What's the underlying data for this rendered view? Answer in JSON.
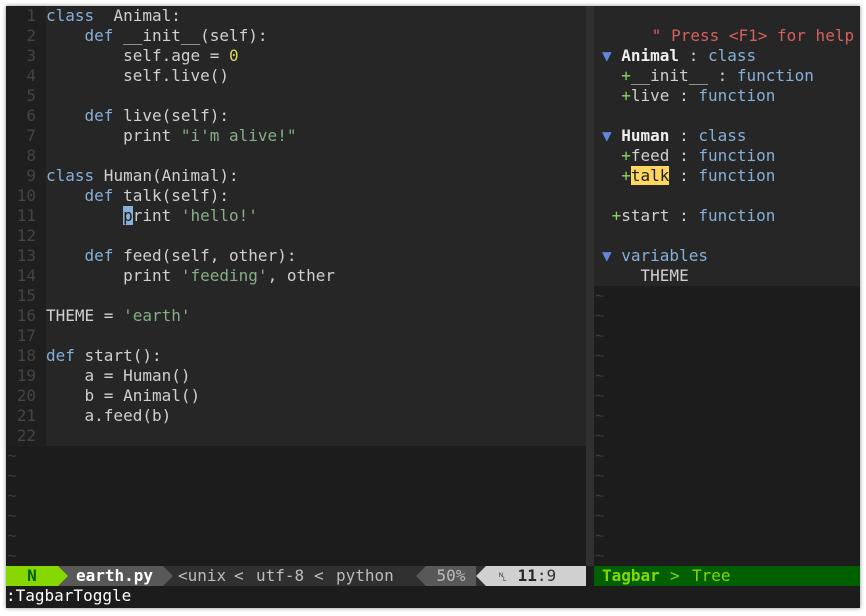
{
  "editor": {
    "lines": [
      {
        "n": "1",
        "segs": [
          [
            "kw",
            "class"
          ],
          [
            "",
            "  "
          ],
          [
            "",
            "Animal:"
          ]
        ]
      },
      {
        "n": "2",
        "segs": [
          [
            "",
            "    "
          ],
          [
            "kw",
            "def"
          ],
          [
            "",
            " __init__(self):"
          ]
        ]
      },
      {
        "n": "3",
        "segs": [
          [
            "",
            "        self.age = "
          ],
          [
            "num",
            "0"
          ]
        ]
      },
      {
        "n": "4",
        "segs": [
          [
            "",
            "        self.live()"
          ]
        ]
      },
      {
        "n": "5",
        "segs": []
      },
      {
        "n": "6",
        "segs": [
          [
            "",
            "    "
          ],
          [
            "kw",
            "def"
          ],
          [
            "",
            " live(self):"
          ]
        ]
      },
      {
        "n": "7",
        "segs": [
          [
            "",
            "        print "
          ],
          [
            "str",
            "\"i'm alive!\""
          ]
        ]
      },
      {
        "n": "8",
        "segs": []
      },
      {
        "n": "9",
        "segs": [
          [
            "kw",
            "class"
          ],
          [
            "",
            " Human(Animal):"
          ]
        ]
      },
      {
        "n": "10",
        "segs": [
          [
            "",
            "    "
          ],
          [
            "kw",
            "def"
          ],
          [
            "",
            " talk(self):"
          ]
        ]
      },
      {
        "n": "11",
        "segs": [
          [
            "",
            "        "
          ],
          [
            "cursor",
            "p"
          ],
          [
            "",
            "rint "
          ],
          [
            "str",
            "'hello!'"
          ]
        ]
      },
      {
        "n": "12",
        "segs": []
      },
      {
        "n": "13",
        "segs": [
          [
            "",
            "    "
          ],
          [
            "kw",
            "def"
          ],
          [
            "",
            " feed(self, other):"
          ]
        ]
      },
      {
        "n": "14",
        "segs": [
          [
            "",
            "        print "
          ],
          [
            "str",
            "'feeding'"
          ],
          [
            "",
            ", other"
          ]
        ]
      },
      {
        "n": "15",
        "segs": []
      },
      {
        "n": "16",
        "segs": [
          [
            "",
            "THEME = "
          ],
          [
            "str",
            "'earth'"
          ]
        ]
      },
      {
        "n": "17",
        "segs": []
      },
      {
        "n": "18",
        "segs": [
          [
            "kw",
            "def"
          ],
          [
            "",
            " start():"
          ]
        ]
      },
      {
        "n": "19",
        "segs": [
          [
            "",
            "    a = Human()"
          ]
        ]
      },
      {
        "n": "20",
        "segs": [
          [
            "",
            "    b = Animal()"
          ]
        ]
      },
      {
        "n": "21",
        "segs": [
          [
            "",
            "    a.feed(b)"
          ]
        ]
      },
      {
        "n": "22",
        "segs": []
      }
    ],
    "tilde": "~"
  },
  "tagbar": {
    "help": "\" Press <F1> for help",
    "lines": [
      {
        "segs": []
      },
      {
        "segs": [
          [
            "tri",
            "▼ "
          ],
          [
            "bold",
            "Animal"
          ],
          [
            "sep",
            " : "
          ],
          [
            "kind",
            "class"
          ]
        ]
      },
      {
        "segs": [
          [
            "",
            "  "
          ],
          [
            "plus",
            "+"
          ],
          [
            "",
            "__init__"
          ],
          [
            "sep",
            " : "
          ],
          [
            "kind",
            "function"
          ]
        ]
      },
      {
        "segs": [
          [
            "",
            "  "
          ],
          [
            "plus",
            "+"
          ],
          [
            "",
            "live"
          ],
          [
            "sep",
            " : "
          ],
          [
            "kind",
            "function"
          ]
        ]
      },
      {
        "segs": []
      },
      {
        "segs": [
          [
            "tri",
            "▼ "
          ],
          [
            "bold",
            "Human"
          ],
          [
            "sep",
            " : "
          ],
          [
            "kind",
            "class"
          ]
        ]
      },
      {
        "segs": [
          [
            "",
            "  "
          ],
          [
            "plus",
            "+"
          ],
          [
            "",
            "feed"
          ],
          [
            "sep",
            " : "
          ],
          [
            "kind",
            "function"
          ]
        ]
      },
      {
        "segs": [
          [
            "",
            "  "
          ],
          [
            "plus",
            "+"
          ],
          [
            "hl",
            "talk"
          ],
          [
            "sep",
            " : "
          ],
          [
            "kind",
            "function"
          ]
        ]
      },
      {
        "segs": []
      },
      {
        "segs": [
          [
            "plus",
            " +"
          ],
          [
            "",
            "start"
          ],
          [
            "sep",
            " : "
          ],
          [
            "kind",
            "function"
          ]
        ]
      },
      {
        "segs": []
      },
      {
        "segs": [
          [
            "tri",
            "▼ "
          ],
          [
            "kind",
            "variables"
          ]
        ]
      },
      {
        "segs": [
          [
            "",
            "    THEME"
          ]
        ]
      }
    ]
  },
  "status": {
    "mode": "N",
    "filename": "earth.py",
    "fileformat": "<unix",
    "encoding": "utf-8",
    "filetype": "python",
    "percent": "50%",
    "line_icon": "␤",
    "line": "11",
    "col": ":9",
    "tagbar_label": "Tagbar",
    "tagbar_mode": "Tree"
  },
  "cmdline": ":TagbarToggle",
  "colors": {
    "keyword": "#87afd7",
    "string": "#87af87",
    "number": "#d7d75f",
    "mode_bg": "#87d700",
    "highlight": "#ffd75f"
  }
}
